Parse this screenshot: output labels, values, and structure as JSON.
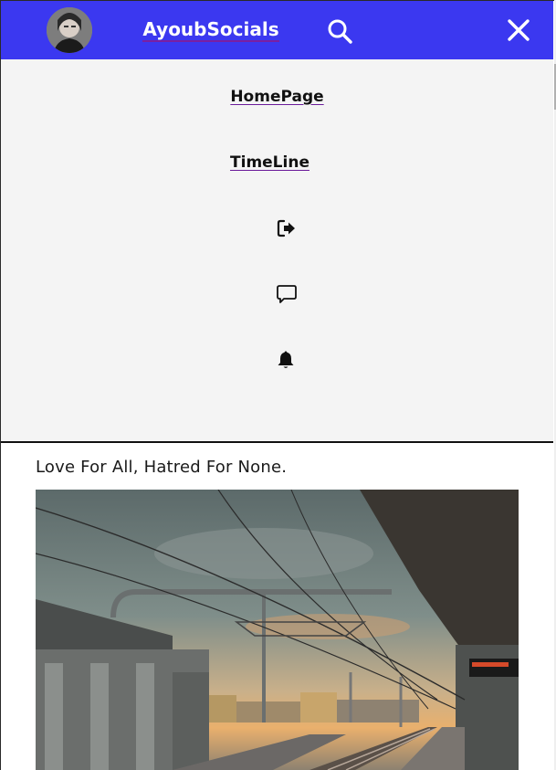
{
  "navbar": {
    "brand": "AyoubSocials",
    "accent_color": "#3b38f0",
    "avatar_icon": "user-avatar",
    "search_icon": "search-icon",
    "close_icon": "close-icon"
  },
  "menu": {
    "items": [
      {
        "label": "HomePage"
      },
      {
        "label": "TimeLine"
      }
    ],
    "icons": [
      "logout-icon",
      "message-icon",
      "bell-icon"
    ]
  },
  "post": {
    "caption": "Love For All, Hatred For None.",
    "image": "train-station-platform-photo"
  }
}
